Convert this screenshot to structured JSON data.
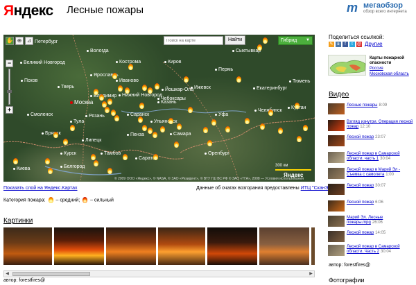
{
  "header": {
    "logo": "Яндекс",
    "logo_first_letter": "Я",
    "logo_rest": "ндекс",
    "title": "Лесные пожары",
    "brand_mark": "m",
    "brand_name": "мегаобзор",
    "brand_tagline": "обзор всего интернета"
  },
  "map": {
    "search_placeholder": "Поиск на карте",
    "find_button": "Найти",
    "layer": "Гибрид",
    "tools": [
      "hand-icon",
      "zoom-box-icon",
      "ruler-icon"
    ],
    "zoom_in": "+",
    "zoom_out": "−",
    "zoom_level": 0.6,
    "scale_label": "300 км",
    "map_logo": "Яндекс",
    "copyright": "© 2009 ООО «Яндекс», © NASA, © ЗАО «Резидент», © ВТУ ГШ ВС РФ © ЗАО «ТГА», 2008 — Условия использования",
    "cities": [
      {
        "name": "Петербург",
        "capital": false
      },
      {
        "name": "Вологда",
        "capital": false
      },
      {
        "name": "Великий Новгород",
        "capital": false
      },
      {
        "name": "Сыктывкар",
        "capital": false
      },
      {
        "name": "Кострома",
        "capital": false
      },
      {
        "name": "Киров",
        "capital": false
      },
      {
        "name": "Ярославль",
        "capital": false
      },
      {
        "name": "Пермь",
        "capital": false
      },
      {
        "name": "Псков",
        "capital": false
      },
      {
        "name": "Тверь",
        "capital": false
      },
      {
        "name": "Иваново",
        "capital": false
      },
      {
        "name": "Йошкар-Ола",
        "capital": false
      },
      {
        "name": "Ижевск",
        "capital": false
      },
      {
        "name": "Екатеринбург",
        "capital": false
      },
      {
        "name": "Тюмень",
        "capital": false
      },
      {
        "name": "Владимир",
        "capital": false
      },
      {
        "name": "Нижний Новгород",
        "capital": false
      },
      {
        "name": "Москва",
        "capital": true
      },
      {
        "name": "Чебоксары",
        "capital": false
      },
      {
        "name": "Казань",
        "capital": false
      },
      {
        "name": "Уфа",
        "capital": false
      },
      {
        "name": "Смоленск",
        "capital": false
      },
      {
        "name": "Рязань",
        "capital": false
      },
      {
        "name": "Челябинск",
        "capital": false
      },
      {
        "name": "Курган",
        "capital": false
      },
      {
        "name": "Тула",
        "capital": false
      },
      {
        "name": "Саранск",
        "capital": false
      },
      {
        "name": "Ульяновск",
        "capital": false
      },
      {
        "name": "Брянск",
        "capital": false
      },
      {
        "name": "Пенза",
        "capital": false
      },
      {
        "name": "Самара",
        "capital": false
      },
      {
        "name": "Липецк",
        "capital": false
      },
      {
        "name": "Курск",
        "capital": false
      },
      {
        "name": "Тамбов",
        "capital": false
      },
      {
        "name": "Оренбург",
        "capital": false
      },
      {
        "name": "Саратов",
        "capital": false
      },
      {
        "name": "Белгород",
        "capital": false
      },
      {
        "name": "Киева",
        "capital": false
      }
    ]
  },
  "below_map": {
    "show_layer_link": "Показать слой на Яндекс.Картах",
    "source_prefix": "Данные об очагах возгорания предоставлены ",
    "source_link": "ИТЦ \"СканЭкс\"",
    "legend_prefix": "Категория пожара: ",
    "legend_medium": "– средний;",
    "legend_strong": "– сильный"
  },
  "pictures": {
    "heading": "Картинки",
    "count": 7,
    "author": "автор: forestfires@"
  },
  "sidebar": {
    "share_label": "Поделиться ссылкой:",
    "share_icons": [
      "lj-icon",
      "vk-icon",
      "facebook-icon",
      "twitter-icon",
      "mail-icon"
    ],
    "share_other": "Другие",
    "map_card": {
      "title": "Карты пожарной опасности",
      "link1": "Россия",
      "link2": "Московская область"
    },
    "video_heading": "Видео",
    "videos": [
      {
        "title": "Лесные пожары",
        "duration": "8:09"
      },
      {
        "title": "Взгляд изнутри. Операция лесной пожар",
        "duration": "12:10"
      },
      {
        "title": "Лесной пожар",
        "duration": "23:07"
      },
      {
        "title": "Лесной пожар в Самарской области. часть 1",
        "duration": "30:04"
      },
      {
        "title": "Лесной пожар в Марий Эл - Съемка с самолета",
        "duration": "1:00"
      },
      {
        "title": "Лесной пожар",
        "duration": "30:07"
      },
      {
        "title": "Лесной пожар",
        "duration": "6:06"
      },
      {
        "title": "Марий Эл. Лесные пожары.mpg",
        "duration": "26:06"
      },
      {
        "title": "Лесной пожар",
        "duration": "14:05"
      },
      {
        "title": "Лесной пожар в Самарской области. Часть 2",
        "duration": "30:04"
      }
    ],
    "author": "автор: forestfires@",
    "photos_heading": "Фотографии"
  },
  "colors": {
    "link": "#0000cc",
    "logo_red": "#ff0000",
    "map_layer_green": "#4caf3d",
    "fire_orange": "#ff8c00"
  }
}
